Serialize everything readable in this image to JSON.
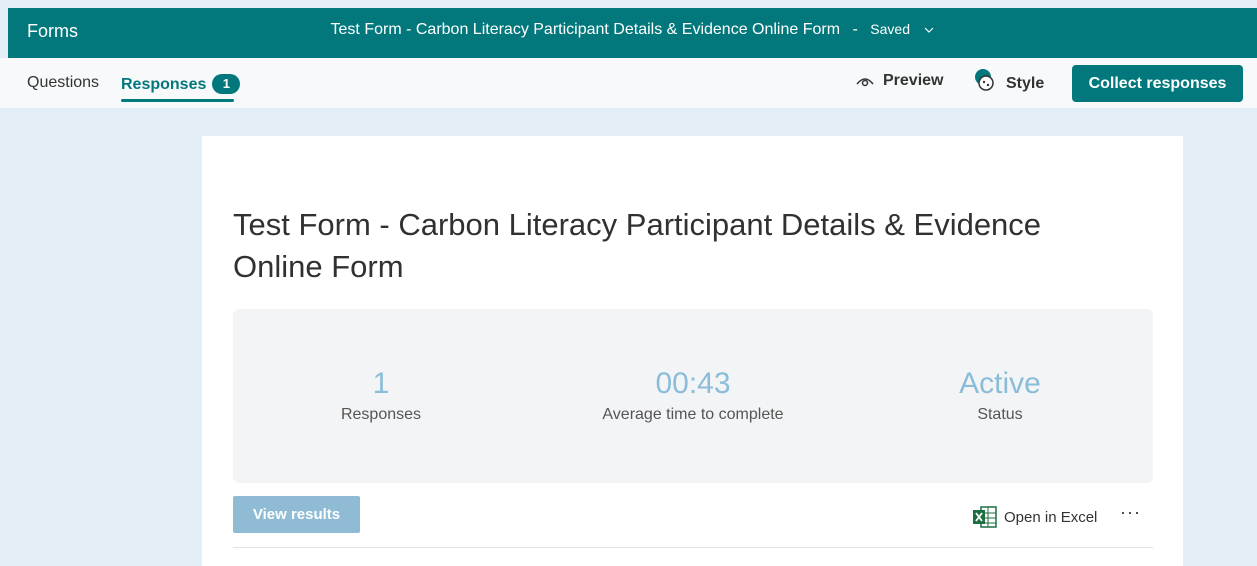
{
  "app": {
    "name": "Forms"
  },
  "header": {
    "doc_title": "Test Form - Carbon Literacy Participant Details & Evidence Online Form",
    "separator": "-",
    "save_status": "Saved"
  },
  "tabs": [
    {
      "label": "Questions"
    },
    {
      "label": "Responses",
      "badge": "1"
    }
  ],
  "toolbar": {
    "preview_label": "Preview",
    "style_label": "Style",
    "collect_label": "Collect responses"
  },
  "form": {
    "title": "Test Form - Carbon Literacy Participant Details & Evidence Online Form"
  },
  "stats": [
    {
      "value": "1",
      "label": "Responses"
    },
    {
      "value": "00:43",
      "label": "Average time to complete"
    },
    {
      "value": "Active",
      "label": "Status"
    }
  ],
  "actions": {
    "view_results_label": "View results",
    "open_excel_label": "Open in Excel",
    "more_label": "···"
  },
  "colors": {
    "brand": "#03787c",
    "stat_value": "#8bbdd9",
    "view_button": "#8fbcd4",
    "excel": "#1d6f42"
  },
  "icons": {
    "preview": "eye-icon",
    "style": "palette-icon",
    "excel": "excel-icon",
    "dropdown": "chevron-down-icon"
  }
}
